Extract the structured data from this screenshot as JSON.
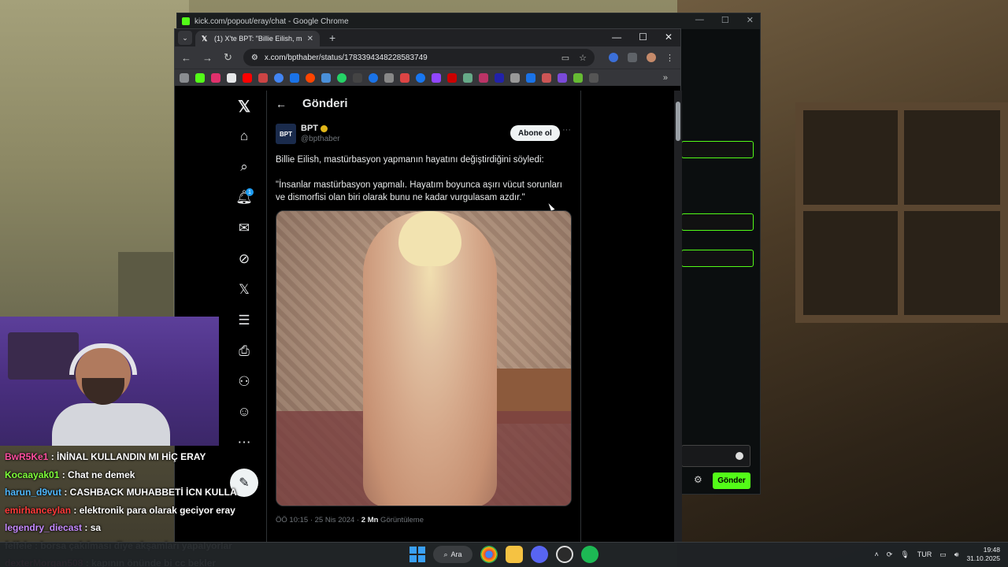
{
  "kick_window": {
    "title": "kick.com/popout/eray/chat - Google Chrome",
    "send_label": "Gönder"
  },
  "chrome": {
    "tab_title": "(1) X'te BPT: \"Billie Eilish, mastü",
    "url": "x.com/bpthaber/status/1783394348228583749"
  },
  "x_nav": {
    "notifications_badge": "1"
  },
  "post": {
    "header_title": "Gönderi",
    "author_name": "BPT",
    "author_handle": "@bpthaber",
    "avatar_text": "BPT",
    "subscribe_label": "Abone ol",
    "more_label": "···",
    "text_line1": "Billie Eilish, mastürbasyon yapmanın hayatını değiştirdiğini söyledi:",
    "text_line2": "\"İnsanlar mastürbasyon yapmalı. Hayatım boyunca aşırı vücut sorunları ve dismorfisi olan biri olarak bunu ne kadar vurgulasam azdır.\"",
    "time": "ÖÖ 10:15 · 25 Nis 2024 · ",
    "views_count": "2 Mn",
    "views_label": " Görüntüleme"
  },
  "chat": [
    {
      "user": "BwR5Ke1",
      "msg": " : İNİNAL KULLANDIN MI HİÇ ERAY",
      "color": "#ff4fa0"
    },
    {
      "user": "Kocaayak01",
      "msg": " : Chat ne demek",
      "color": "#7fff3a"
    },
    {
      "user": "harun_d9vut",
      "msg": " : CASHBACK MUHABBETİ İCN KULLA",
      "color": "#4fb8ff"
    },
    {
      "user": "emirhanceylan",
      "msg": " : elektronik para olarak geciyor eray",
      "color": "#ff3a3a"
    },
    {
      "user": "legendry_diecast",
      "msg": " : sa",
      "color": "#c58aff"
    },
    {
      "user": "felfele",
      "msg": " : borsa çakılması diye akşamları yapalyorlar",
      "color": "#ffffff"
    },
    {
      "user": "dexterMorgan508",
      "msg": " : kapının önünde bi cc bekler",
      "color": "#ff4fa0"
    }
  ],
  "taskbar": {
    "search_label": "Ara",
    "lang": "TUR",
    "time": "19:48",
    "date": "31.10.2025"
  }
}
